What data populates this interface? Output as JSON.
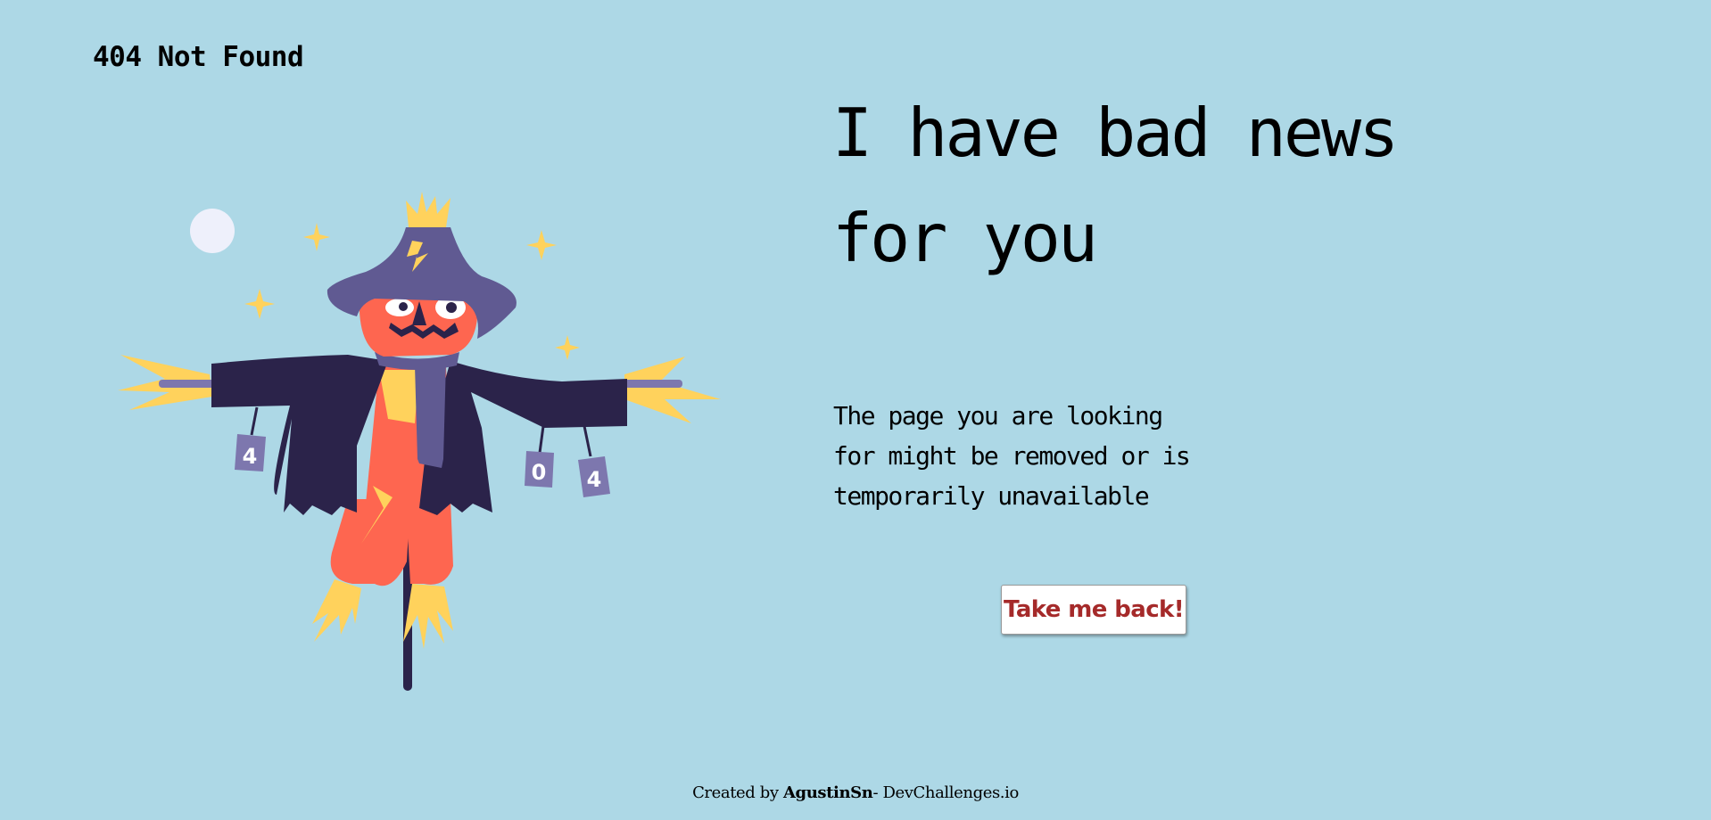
{
  "header": {
    "title": "404 Not Found"
  },
  "main": {
    "headline_line1": "I have bad news",
    "headline_line2": "for you",
    "message_line1": "The page you are looking",
    "message_line2": "for might be removed or is",
    "message_line3": "temporarily unavailable",
    "back_button_label": "Take me back!"
  },
  "illustration": {
    "name": "scarecrow-illustration",
    "can_labels": [
      "4",
      "0",
      "4"
    ]
  },
  "footer": {
    "prefix": "Created by ",
    "author": "AgustinSn",
    "suffix": "- DevChallenges.io"
  },
  "colors": {
    "background": "#add8e6",
    "button_text": "#a52a2a",
    "coat": "#2b234a",
    "hat": "#605a92",
    "face": "#fe6650",
    "straw": "#ffd25c",
    "can": "#7d77ae",
    "moon": "#eef0fb"
  }
}
